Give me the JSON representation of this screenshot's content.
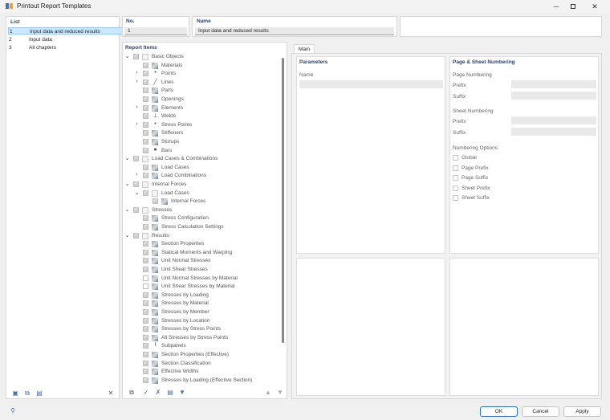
{
  "window": {
    "title": "Printout Report Templates"
  },
  "list": {
    "header": "List",
    "items": [
      {
        "num": "1",
        "name": "Input data and reduced results",
        "selected": true
      },
      {
        "num": "2",
        "name": "Input data",
        "selected": false
      },
      {
        "num": "3",
        "name": "All chapters",
        "selected": false
      }
    ]
  },
  "no": {
    "label": "No.",
    "value": "1"
  },
  "name": {
    "label": "Name",
    "value": "Input data and reduced results"
  },
  "report_items": {
    "header": "Report Items",
    "rows": [
      {
        "label": "Basic Objects",
        "level": 0,
        "arrow": "down",
        "checked": true,
        "icon": "folder-icon"
      },
      {
        "label": "Materials",
        "level": 1,
        "arrow": "",
        "checked": true,
        "icon": "materials-icon"
      },
      {
        "label": "Points",
        "level": 1,
        "arrow": "right",
        "checked": true,
        "icon": "point-icon"
      },
      {
        "label": "Lines",
        "level": 1,
        "arrow": "right",
        "checked": true,
        "icon": "line-icon"
      },
      {
        "label": "Parts",
        "level": 1,
        "arrow": "",
        "checked": true,
        "icon": "parts-icon"
      },
      {
        "label": "Openings",
        "level": 1,
        "arrow": "",
        "checked": true,
        "icon": "openings-icon"
      },
      {
        "label": "Elements",
        "level": 1,
        "arrow": "right",
        "checked": true,
        "icon": "element-icon"
      },
      {
        "label": "Welds",
        "level": 1,
        "arrow": "",
        "checked": true,
        "icon": "weld-icon"
      },
      {
        "label": "Stress Points",
        "level": 1,
        "arrow": "right",
        "checked": true,
        "icon": "point-icon"
      },
      {
        "label": "Stiffeners",
        "level": 1,
        "arrow": "",
        "checked": true,
        "icon": "stiffener-icon"
      },
      {
        "label": "Stirrups",
        "level": 1,
        "arrow": "",
        "checked": true,
        "icon": "stirrup-icon"
      },
      {
        "label": "Bars",
        "level": 1,
        "arrow": "",
        "checked": true,
        "icon": "bar-icon"
      },
      {
        "label": "Load Cases & Combinations",
        "level": 0,
        "arrow": "down",
        "checked": true,
        "icon": "folder-icon"
      },
      {
        "label": "Load Cases",
        "level": 1,
        "arrow": "",
        "checked": true,
        "icon": "load-case-icon"
      },
      {
        "label": "Load Combinations",
        "level": 1,
        "arrow": "right",
        "checked": true,
        "icon": "load-combination-icon"
      },
      {
        "label": "Internal Forces",
        "level": 0,
        "arrow": "down",
        "checked": true,
        "icon": "folder-icon"
      },
      {
        "label": "Load Cases",
        "level": 1,
        "arrow": "down",
        "checked": true,
        "icon": "folder-icon"
      },
      {
        "label": "Internal Forces",
        "level": 2,
        "arrow": "",
        "checked": true,
        "icon": "internal-forces-icon"
      },
      {
        "label": "Stresses",
        "level": 0,
        "arrow": "down",
        "checked": true,
        "icon": "folder-icon"
      },
      {
        "label": "Stress Configuration",
        "level": 1,
        "arrow": "",
        "checked": true,
        "icon": "stress-config-icon"
      },
      {
        "label": "Stress Calculation Settings",
        "level": 1,
        "arrow": "",
        "checked": true,
        "icon": "stress-config-icon"
      },
      {
        "label": "Results",
        "level": 0,
        "arrow": "down",
        "checked": true,
        "icon": "folder-icon"
      },
      {
        "label": "Section Properties",
        "level": 1,
        "arrow": "",
        "checked": true,
        "icon": "section-props-icon"
      },
      {
        "label": "Statical Moments and Warping",
        "level": 1,
        "arrow": "",
        "checked": true,
        "icon": "result-icon"
      },
      {
        "label": "Unit Normal Stresses",
        "level": 1,
        "arrow": "",
        "checked": true,
        "icon": "result-icon"
      },
      {
        "label": "Unit Shear Stresses",
        "level": 1,
        "arrow": "",
        "checked": true,
        "icon": "result-icon"
      },
      {
        "label": "Unit Normal Stresses by Material",
        "level": 1,
        "arrow": "",
        "checked": false,
        "icon": "result-icon"
      },
      {
        "label": "Unit Shear Stresses by Material",
        "level": 1,
        "arrow": "",
        "checked": false,
        "icon": "result-icon"
      },
      {
        "label": "Stresses by Loading",
        "level": 1,
        "arrow": "",
        "checked": true,
        "icon": "result-icon"
      },
      {
        "label": "Stresses by Material",
        "level": 1,
        "arrow": "",
        "checked": true,
        "icon": "result-icon"
      },
      {
        "label": "Stresses by Member",
        "level": 1,
        "arrow": "",
        "checked": true,
        "icon": "result-icon"
      },
      {
        "label": "Stresses by Location",
        "level": 1,
        "arrow": "",
        "checked": true,
        "icon": "result-icon"
      },
      {
        "label": "Stresses by Stress Points",
        "level": 1,
        "arrow": "",
        "checked": true,
        "icon": "result-icon"
      },
      {
        "label": "All Stresses by Stress Points",
        "level": 1,
        "arrow": "",
        "checked": true,
        "icon": "result-icon"
      },
      {
        "label": "Subpanels",
        "level": 1,
        "arrow": "",
        "checked": true,
        "icon": "subpanel-icon"
      },
      {
        "label": "Section Properties (Effective)",
        "level": 1,
        "arrow": "",
        "checked": true,
        "icon": "section-props-icon"
      },
      {
        "label": "Section Classification",
        "level": 1,
        "arrow": "",
        "checked": true,
        "icon": "result-icon"
      },
      {
        "label": "Effective Widths",
        "level": 1,
        "arrow": "",
        "checked": true,
        "icon": "result-icon"
      },
      {
        "label": "Stresses by Loading (Effective Section)",
        "level": 1,
        "arrow": "",
        "checked": true,
        "icon": "result-icon"
      }
    ]
  },
  "main_tab": {
    "label": "Main"
  },
  "parameters": {
    "header": "Parameters",
    "name_label": "Name"
  },
  "numbering": {
    "header": "Page & Sheet Numbering",
    "page_numbering": "Page Numbering",
    "sheet_numbering": "Sheet Numbering",
    "prefix": "Prefix",
    "suffix": "Suffix",
    "options_header": "Numbering Options",
    "options": [
      "Global",
      "Page Prefix",
      "Page Suffix",
      "Sheet Prefix",
      "Sheet Suffix"
    ]
  },
  "buttons": {
    "ok": "OK",
    "cancel": "Cancel",
    "apply": "Apply"
  },
  "colors": {
    "accent": "#2b4470",
    "selection": "#cce8ff",
    "primary_border": "#2f6fbf"
  }
}
